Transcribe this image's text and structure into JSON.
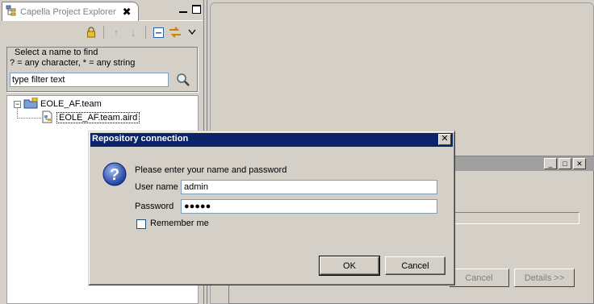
{
  "explorer": {
    "tab_title": "Capella Project Explorer",
    "filter": {
      "legend": "Select a name to find",
      "description": "? = any character, * = any string",
      "value": "type filter text"
    },
    "tree": {
      "items": [
        {
          "label": "EOLE_AF.team",
          "expanded": true
        },
        {
          "label": "EOLE_AF.team.aird",
          "selected": true
        }
      ]
    }
  },
  "background_dialog": {
    "cancel_label": "Cancel",
    "details_label": "Details >>"
  },
  "modal": {
    "title": "Repository connection",
    "prompt": "Please enter your name and password",
    "username_label": "User name",
    "username_value": "admin",
    "password_label": "Password",
    "password_value": "●●●●●",
    "remember_label": "Remember me",
    "remember_checked": false,
    "ok_label": "OK",
    "cancel_label": "Cancel"
  },
  "colors": {
    "titlebar_active": "#0a246a",
    "face": "#d4d0c8",
    "input_border": "#7f9db9"
  }
}
